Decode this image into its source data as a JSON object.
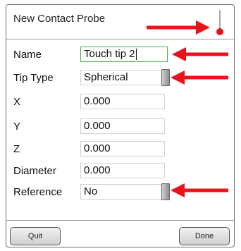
{
  "dialog": {
    "title": "New Contact Probe"
  },
  "fields": {
    "name": {
      "label": "Name",
      "value": "Touch tip 2"
    },
    "tip_type": {
      "label": "Tip Type",
      "value": "Spherical"
    },
    "x": {
      "label": "X",
      "value": "0.000"
    },
    "y": {
      "label": "Y",
      "value": "0.000"
    },
    "z": {
      "label": "Z",
      "value": "0.000"
    },
    "diameter": {
      "label": "Diameter",
      "value": "0.000"
    },
    "reference": {
      "label": "Reference",
      "value": "No"
    }
  },
  "buttons": {
    "quit": "Quit",
    "done": "Done"
  },
  "icons": {
    "probe": "probe-icon",
    "annotation": "arrow-annotation"
  },
  "colors": {
    "annotation_arrow": "#e8141b",
    "active_border": "#4caf50",
    "probe_tip": "#e8141b"
  }
}
